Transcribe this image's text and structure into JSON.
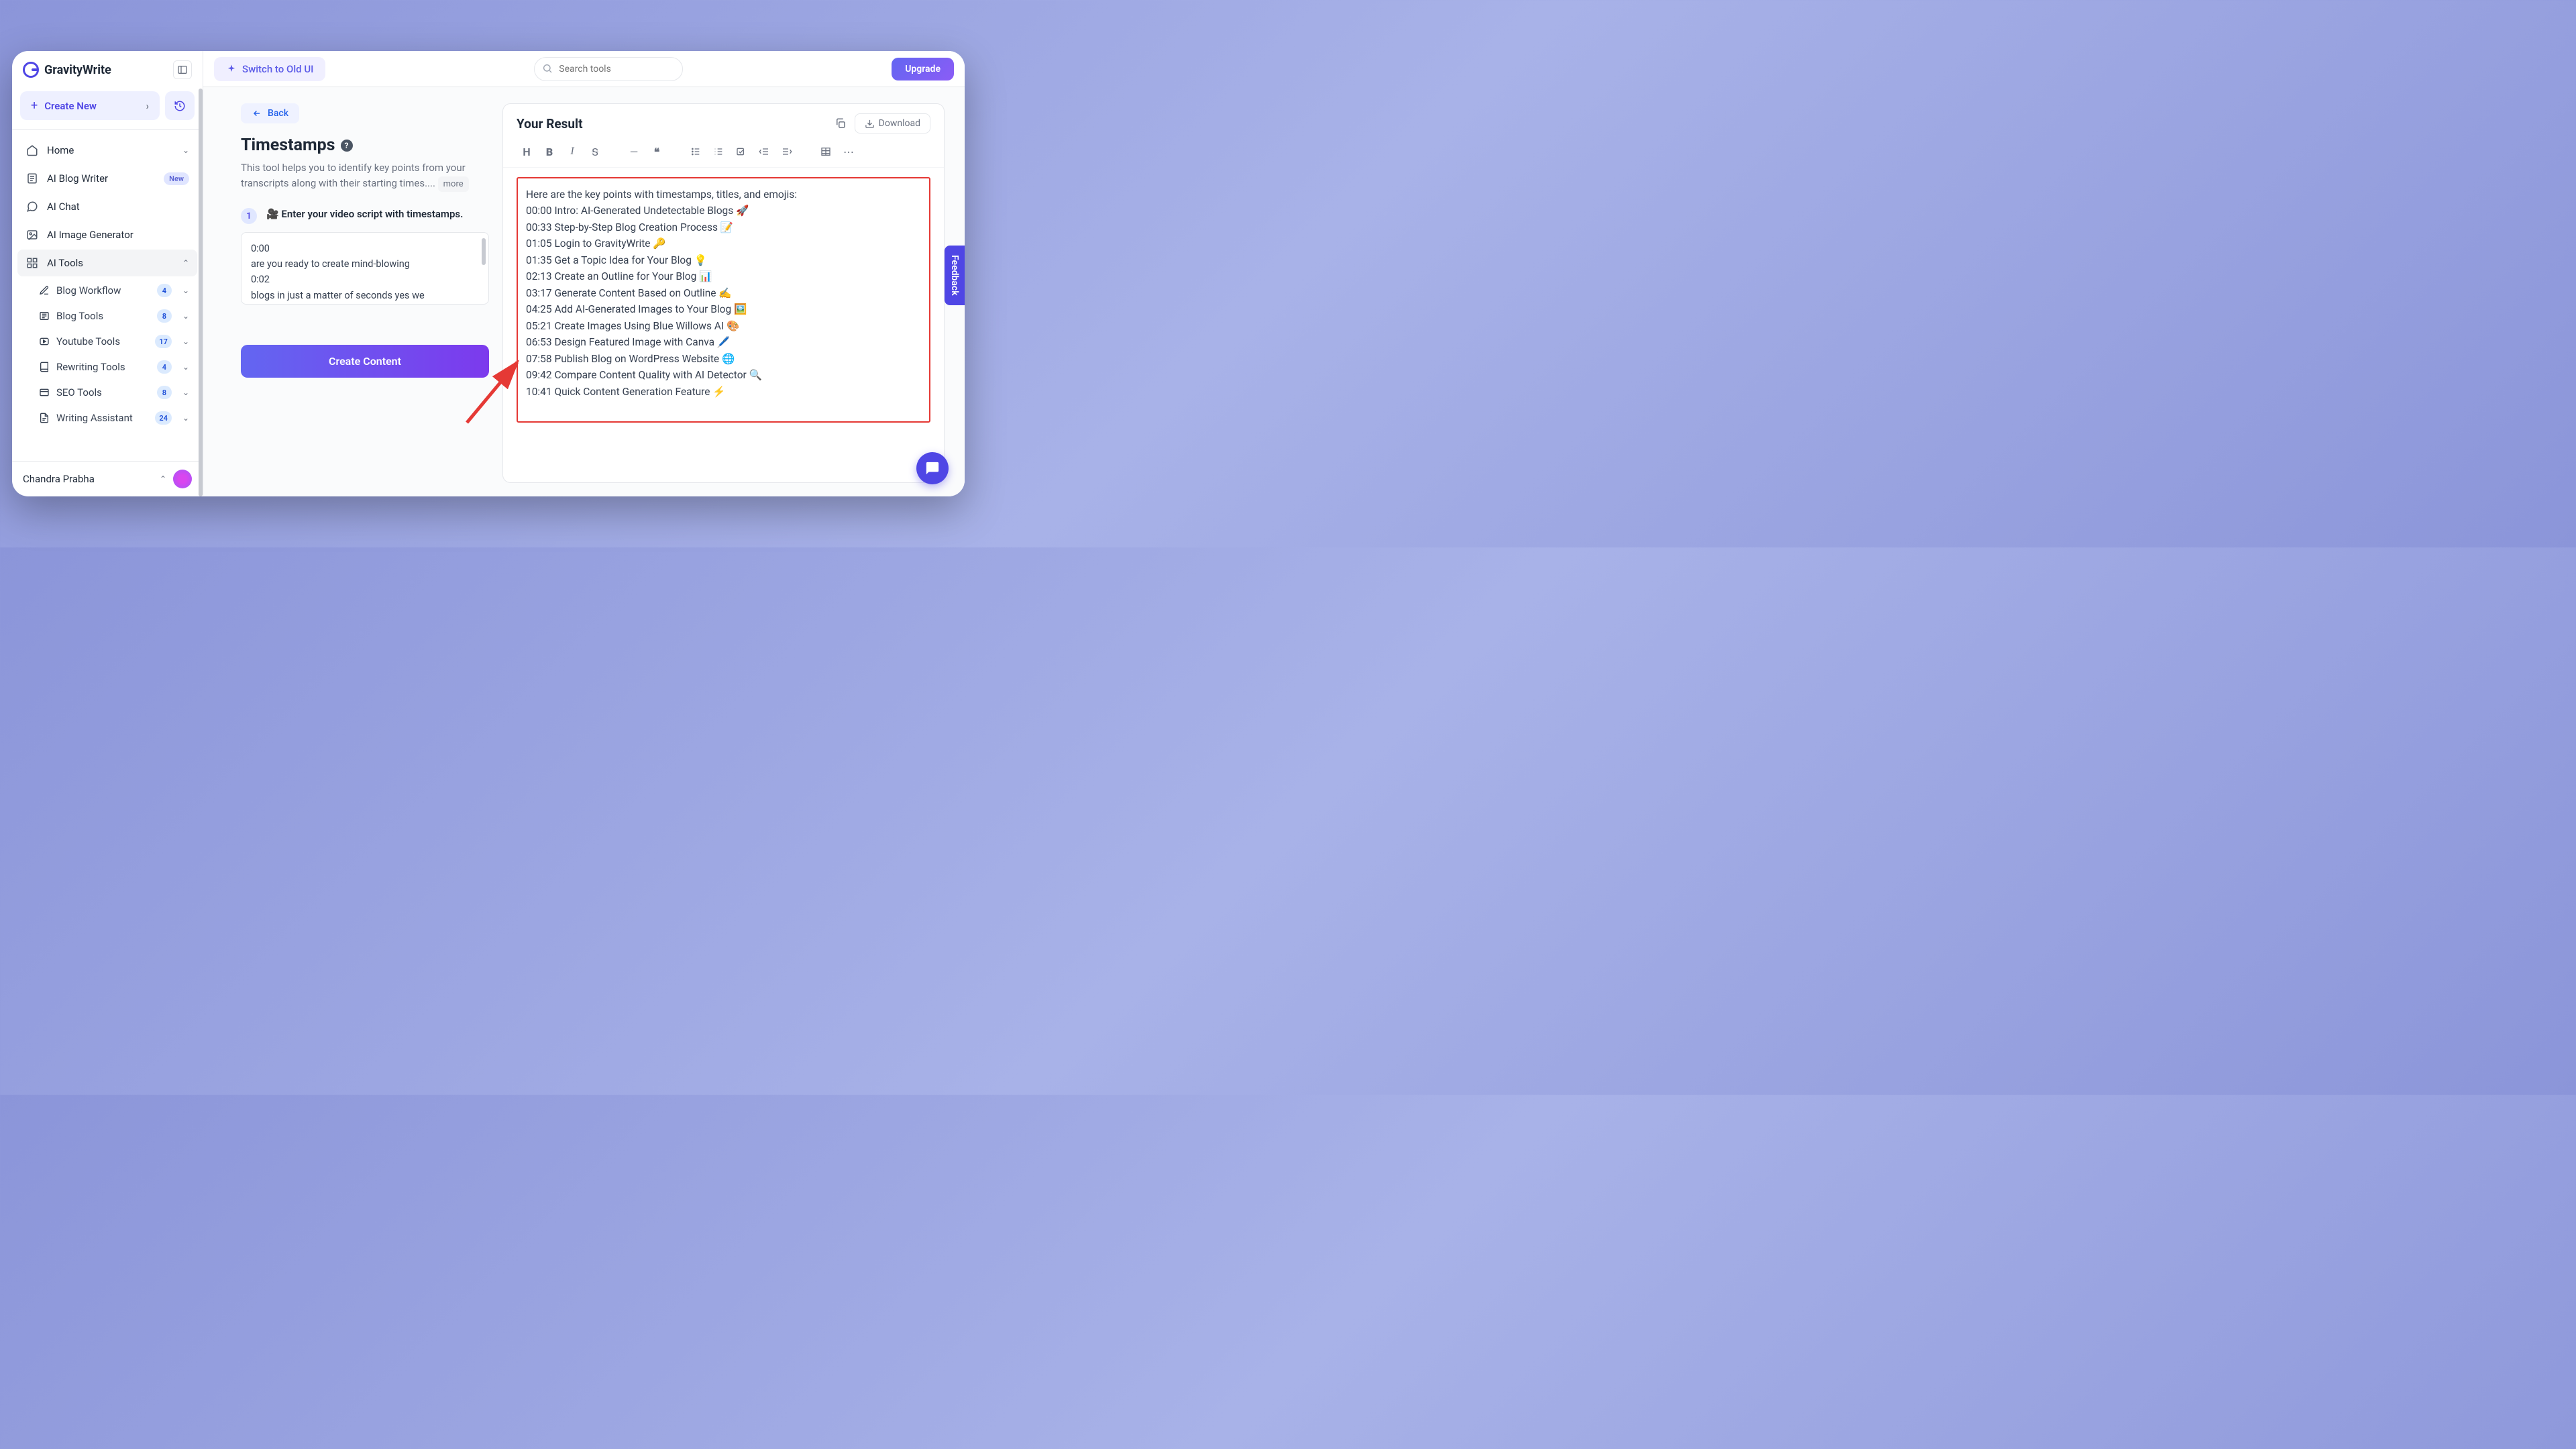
{
  "brand": {
    "name": "GravityWrite"
  },
  "sidebar": {
    "create_label": "Create New",
    "items": [
      {
        "label": "Home"
      },
      {
        "label": "AI Blog Writer",
        "badge": "New"
      },
      {
        "label": "AI Chat"
      },
      {
        "label": "AI Image Generator"
      },
      {
        "label": "AI Tools"
      }
    ],
    "subitems": [
      {
        "label": "Blog Workflow",
        "count": "4"
      },
      {
        "label": "Blog Tools",
        "count": "8"
      },
      {
        "label": "Youtube Tools",
        "count": "17"
      },
      {
        "label": "Rewriting Tools",
        "count": "4"
      },
      {
        "label": "SEO Tools",
        "count": "8"
      },
      {
        "label": "Writing Assistant",
        "count": "24"
      }
    ],
    "user": "Chandra Prabha"
  },
  "topbar": {
    "switch_label": "Switch to Old UI",
    "search_placeholder": "Search tools",
    "upgrade_label": "Upgrade"
  },
  "tool": {
    "back_label": "Back",
    "title": "Timestamps",
    "description": "This tool helps you to identify key points from your transcripts along with their starting times....",
    "more_label": "more",
    "step_number": "1",
    "step_label": "🎥 Enter your video script with timestamps.",
    "script_lines": [
      "0:00",
      "are you ready to create mind-blowing",
      "0:02",
      "blogs in just a matter of seconds yes we"
    ],
    "create_btn": "Create Content"
  },
  "result": {
    "title": "Your Result",
    "download_label": "Download",
    "intro": "Here are the key points with timestamps, titles, and emojis:",
    "lines": [
      "00:00 Intro: AI-Generated Undetectable Blogs 🚀",
      "00:33 Step-by-Step Blog Creation Process 📝",
      "01:05 Login to GravityWrite 🔑",
      "01:35 Get a Topic Idea for Your Blog 💡",
      "02:13 Create an Outline for Your Blog 📊",
      "03:17 Generate Content Based on Outline ✍️",
      "04:25 Add AI-Generated Images to Your Blog 🖼️",
      "05:21 Create Images Using Blue Willows AI 🎨",
      "06:53 Design Featured Image with Canva 🖊️",
      "07:58 Publish Blog on WordPress Website 🌐",
      "09:42 Compare Content Quality with AI Detector 🔍",
      "10:41 Quick Content Generation Feature ⚡"
    ]
  },
  "feedback_label": "Feedback"
}
